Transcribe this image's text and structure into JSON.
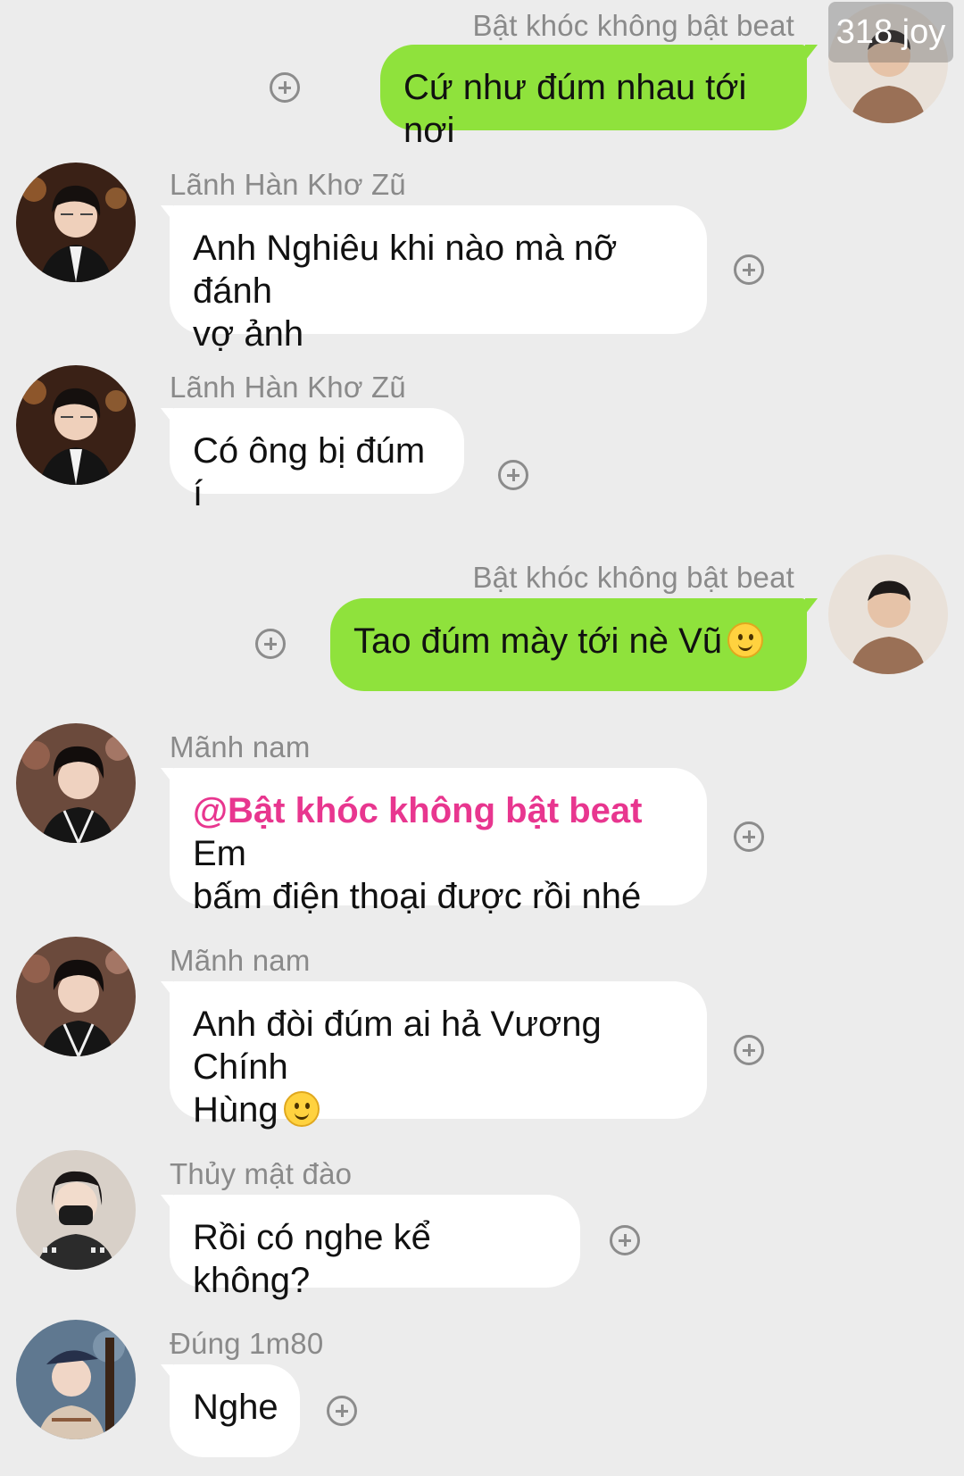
{
  "watermark": "318 joy",
  "messages": [
    {
      "side": "right",
      "sender": "Bật khóc không bật beat",
      "text": "Cứ như đúm nhau tới nơi"
    },
    {
      "side": "left",
      "sender": "Lãnh Hàn Khơ Zũ",
      "line1": "Anh Nghiêu khi nào mà nỡ đánh",
      "line2": "vợ ảnh"
    },
    {
      "side": "left",
      "sender": "Lãnh Hàn Khơ Zũ",
      "text": "Có ông bị đúm í"
    },
    {
      "side": "right",
      "sender": "Bật khóc không bật beat",
      "text": "Tao đúm mày tới nè Vũ",
      "emoji": "smile-emoji"
    },
    {
      "side": "left",
      "sender": "Mãnh nam",
      "mention": "@Bật khóc không bật beat",
      "line1_rest": " Em",
      "line2": "bấm điện thoại được rồi nhé"
    },
    {
      "side": "left",
      "sender": "Mãnh nam",
      "line1": "Anh đòi đúm ai hả Vương Chính",
      "line2": "Hùng",
      "emoji": "smile-emoji"
    },
    {
      "side": "left",
      "sender": "Thủy mật đào",
      "text": "Rồi có nghe kể không?"
    },
    {
      "side": "left",
      "sender": "Đúng 1m80",
      "text": "Nghe"
    }
  ],
  "colors": {
    "sent_bubble": "#8fe23c",
    "received_bubble": "#ffffff",
    "mention": "#e8368f",
    "background": "#ececec"
  }
}
